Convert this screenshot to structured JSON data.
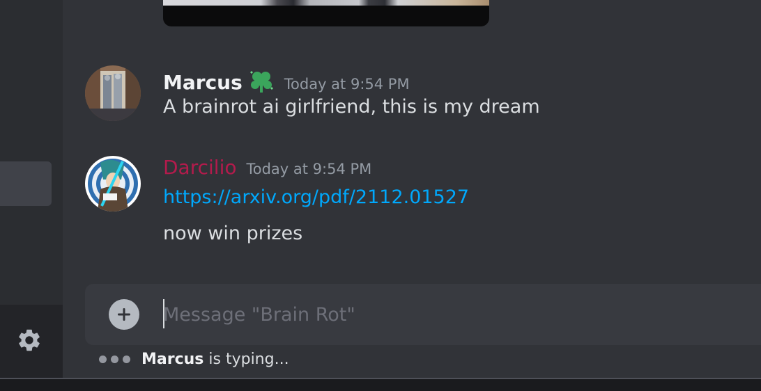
{
  "channel": {
    "composer_placeholder": "Message \"Brain Rot\""
  },
  "messages": [
    {
      "author": "Marcus",
      "timestamp": "Today at 9:54 PM",
      "badge_icon": "clover-heart-icon",
      "badge_color": "#3ba55c",
      "lines": [
        "A brainrot ai girlfriend, this is my dream"
      ]
    },
    {
      "author": "Darcilio",
      "author_color": "#b31b4c",
      "timestamp": "Today at 9:54 PM",
      "link": "https://arxiv.org/pdf/2112.01527",
      "lines": [
        "now win prizes"
      ]
    }
  ],
  "typing_indicator": {
    "user": "Marcus",
    "text": "is typing..."
  },
  "colors": {
    "background": "#313338",
    "link": "#00a8fc",
    "composer": "#383a40"
  }
}
